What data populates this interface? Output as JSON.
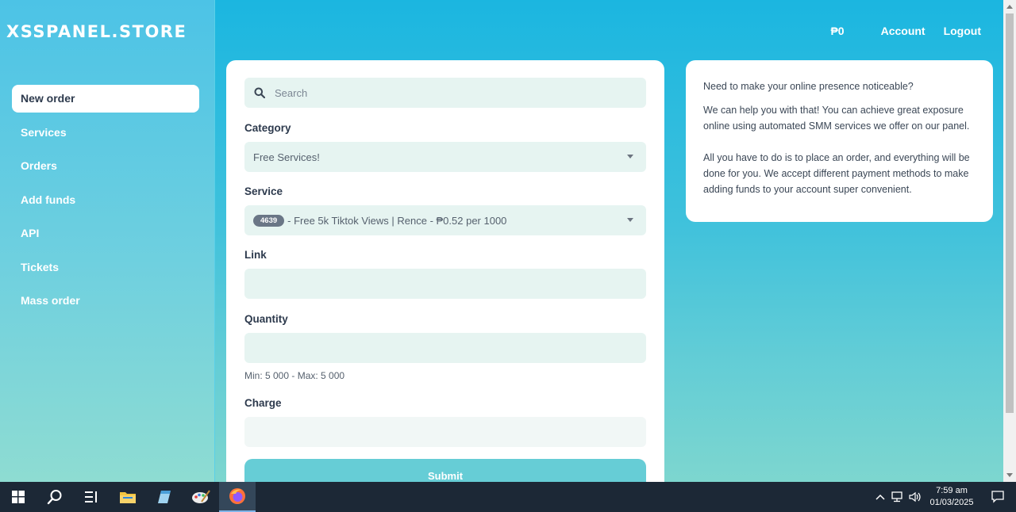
{
  "brand": "XSSPANEL.STORE",
  "sidebar": {
    "items": [
      {
        "label": "New order"
      },
      {
        "label": "Services"
      },
      {
        "label": "Orders"
      },
      {
        "label": "Add funds"
      },
      {
        "label": "API"
      },
      {
        "label": "Tickets"
      },
      {
        "label": "Mass order"
      }
    ]
  },
  "topbar": {
    "balance": "₱0",
    "account": "Account",
    "logout": "Logout"
  },
  "order": {
    "search_placeholder": "Search",
    "category_label": "Category",
    "category_value": "Free Services!",
    "service_label": "Service",
    "service_id": "4639",
    "service_value": "- Free 5k Tiktok Views | Rence - ₱0.52 per 1000",
    "link_label": "Link",
    "link_value": "",
    "quantity_label": "Quantity",
    "quantity_value": "",
    "quantity_hint": "Min: 5 000 - Max: 5 000",
    "charge_label": "Charge",
    "charge_value": "",
    "submit_label": "Submit"
  },
  "info": {
    "line1": "Need to make your online presence noticeable?",
    "line2": "We can help you with that! You can achieve great exposure online using automated SMM services we offer on our panel.",
    "line3": "All you have to do is to place an order, and everything will be done for you. We accept different payment methods to make adding funds to your account super convenient."
  },
  "taskbar": {
    "time": "7:59 am",
    "date": "01/03/2025"
  },
  "colors": {
    "sidebar_top": "#4cc3e6",
    "main_bg": "#1bb6e0",
    "field_bg": "#e6f4f1",
    "submit_bg": "#66cdd6",
    "text_dark": "#2d3a4d"
  }
}
